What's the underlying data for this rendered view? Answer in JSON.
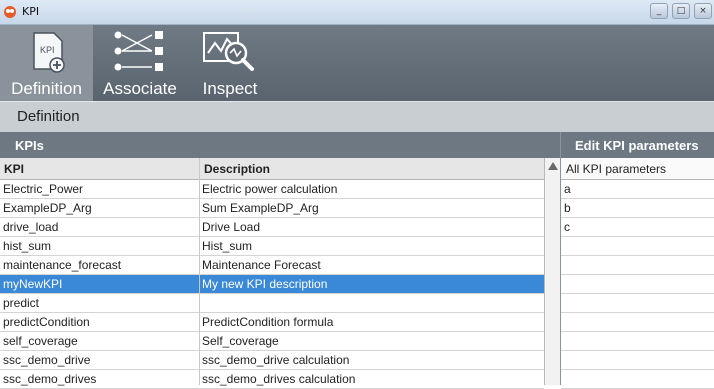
{
  "window": {
    "title": "KPI"
  },
  "toolbar": {
    "items": [
      {
        "label": "Definition",
        "icon": "kpi-add-icon",
        "active": true
      },
      {
        "label": "Associate",
        "icon": "associate-nodes-icon",
        "active": false
      },
      {
        "label": "Inspect",
        "icon": "inspect-chart-icon",
        "active": false
      }
    ]
  },
  "subbar": {
    "title": "Definition"
  },
  "kpis_panel": {
    "header": "KPIs",
    "columns": [
      "KPI",
      "Description"
    ],
    "rows": [
      {
        "kpi": "Electric_Power",
        "description": "Electric power calculation"
      },
      {
        "kpi": "ExampleDP_Arg",
        "description": "Sum ExampleDP_Arg"
      },
      {
        "kpi": "drive_load",
        "description": "Drive Load"
      },
      {
        "kpi": "hist_sum",
        "description": "Hist_sum"
      },
      {
        "kpi": "maintenance_forecast",
        "description": "Maintenance Forecast"
      },
      {
        "kpi": "myNewKPI",
        "description": "My new KPI description"
      },
      {
        "kpi": "predict",
        "description": ""
      },
      {
        "kpi": "predictCondition",
        "description": "PredictCondition formula"
      },
      {
        "kpi": "self_coverage",
        "description": "Self_coverage"
      },
      {
        "kpi": "ssc_demo_drive",
        "description": "ssc_demo_drive calculation"
      },
      {
        "kpi": "ssc_demo_drives",
        "description": "ssc_demo_drives calculation"
      }
    ],
    "selected_row": 5
  },
  "params_panel": {
    "header": "Edit KPI parameters",
    "column": "All KPI parameters",
    "rows": [
      "a",
      "b",
      "c"
    ]
  },
  "colors": {
    "toolbar": "#5f6973",
    "selection": "#3a88d8",
    "header": "#6e7882"
  }
}
